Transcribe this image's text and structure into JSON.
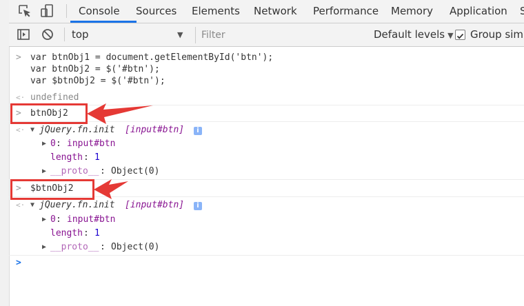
{
  "tabs": [
    {
      "label": "Console",
      "active": true
    },
    {
      "label": "Sources",
      "active": false
    },
    {
      "label": "Elements",
      "active": false
    },
    {
      "label": "Network",
      "active": false
    },
    {
      "label": "Performance",
      "active": false
    },
    {
      "label": "Memory",
      "active": false
    },
    {
      "label": "Application",
      "active": false
    },
    {
      "label": "S",
      "active": false
    }
  ],
  "toolbar": {
    "context": "top",
    "filter_placeholder": "Filter",
    "levels": "Default levels",
    "group_label": "Group simila",
    "group_checked": true
  },
  "console": {
    "input1": [
      "var btnObj1 = document.getElementById('btn');",
      "var btnObj2 = $('#btn');",
      "var $btnObj2 = $('#btn');"
    ],
    "output1": "undefined",
    "input2": "btnObj2",
    "result2": {
      "summary_name": "jQuery.fn.init",
      "summary_detail": "[input#btn]",
      "item0_key": "0",
      "item0_val": "input#btn",
      "length_key": "length",
      "length_val": "1",
      "proto_key": "__proto__",
      "proto_val": "Object(0)"
    },
    "input3": "$btnObj2",
    "result3": {
      "summary_name": "jQuery.fn.init",
      "summary_detail": "[input#btn]",
      "item0_key": "0",
      "item0_val": "input#btn",
      "length_key": "length",
      "length_val": "1",
      "proto_key": "__proto__",
      "proto_val": "Object(0)"
    }
  },
  "colors": {
    "accent": "#1a73e8",
    "annotation": "#e53935"
  }
}
